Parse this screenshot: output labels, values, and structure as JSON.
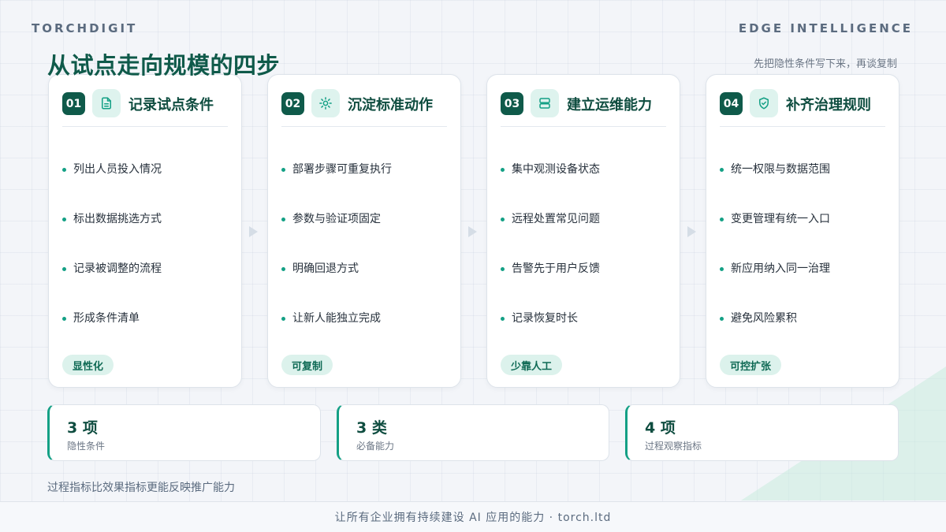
{
  "brand_left": "TORCHDIGIT",
  "brand_right": "EDGE INTELLIGENCE",
  "title": "从试点走向规模的四步",
  "subtitle": "先把隐性条件写下来，再谈复制",
  "colors": {
    "accent": "#0f5a4a",
    "accent_light": "#def3ee",
    "dot": "#14a085"
  },
  "steps": [
    {
      "num": "01",
      "icon": "document-icon",
      "title": "记录试点条件",
      "items": [
        "列出人员投入情况",
        "标出数据挑选方式",
        "记录被调整的流程",
        "形成条件清单"
      ],
      "tag": "显性化"
    },
    {
      "num": "02",
      "icon": "sun-icon",
      "title": "沉淀标准动作",
      "items": [
        "部署步骤可重复执行",
        "参数与验证项固定",
        "明确回退方式",
        "让新人能独立完成"
      ],
      "tag": "可复制"
    },
    {
      "num": "03",
      "icon": "server-icon",
      "title": "建立运维能力",
      "items": [
        "集中观测设备状态",
        "远程处置常见问题",
        "告警先于用户反馈",
        "记录恢复时长"
      ],
      "tag": "少靠人工"
    },
    {
      "num": "04",
      "icon": "shield-check-icon",
      "title": "补齐治理规则",
      "items": [
        "统一权限与数据范围",
        "变更管理有统一入口",
        "新应用纳入同一治理",
        "避免风险累积"
      ],
      "tag": "可控扩张"
    }
  ],
  "stats": [
    {
      "value": "3 项",
      "label": "隐性条件"
    },
    {
      "value": "3 类",
      "label": "必备能力"
    },
    {
      "value": "4 项",
      "label": "过程观察指标"
    }
  ],
  "note": "过程指标比效果指标更能反映推广能力",
  "footer": "让所有企业拥有持续建设 AI 应用的能力 · torch.ltd"
}
